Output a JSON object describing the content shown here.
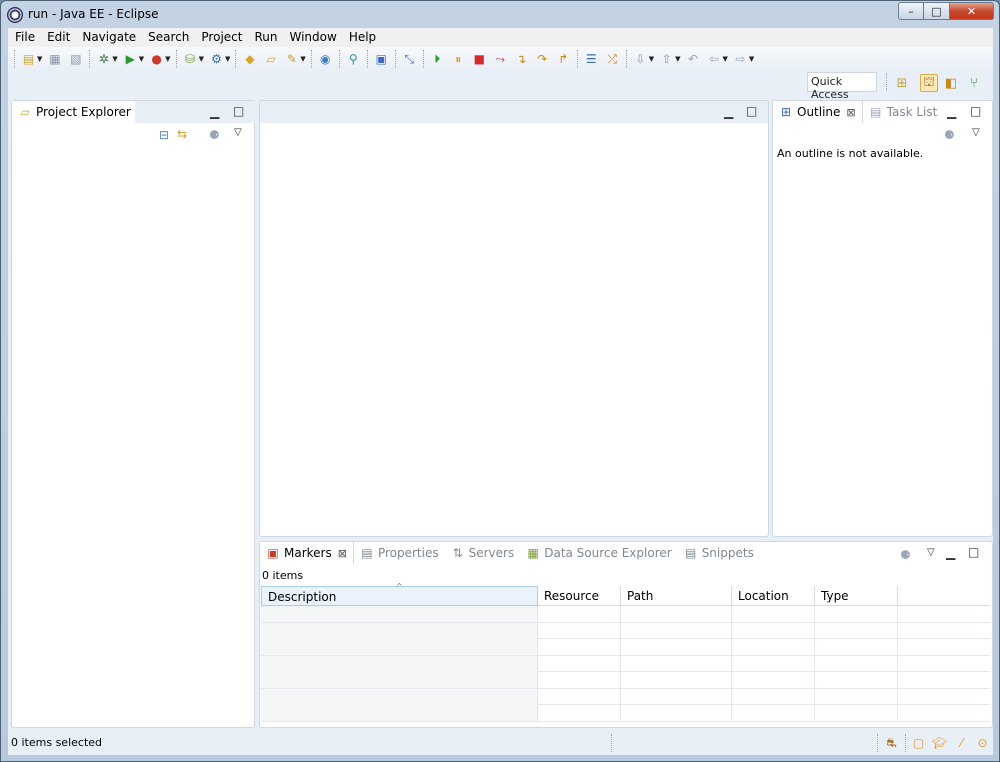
{
  "window": {
    "title": "run - Java EE - Eclipse",
    "min": "–",
    "max": "□",
    "close": "✕"
  },
  "menu": [
    "File",
    "Edit",
    "Navigate",
    "Search",
    "Project",
    "Run",
    "Window",
    "Help"
  ],
  "quick_access": "Quick Access",
  "project_explorer": {
    "title": "Project Explorer",
    "close": "⊠"
  },
  "outline": {
    "title": "Outline",
    "close": "⊠",
    "tab2": "Task List",
    "message": "An outline is not available."
  },
  "bottom": {
    "tabs": [
      "Markers",
      "Properties",
      "Servers",
      "Data Source Explorer",
      "Snippets"
    ],
    "count": "0 items",
    "columns": [
      "Description",
      "Resource",
      "Path",
      "Location",
      "Type"
    ],
    "sort_indicator": "^"
  },
  "status": {
    "selected": "0 items selected"
  },
  "colors": {
    "title_bg": "#c4d3e4",
    "close_btn": "#c6371a",
    "tab_active_bg": "#ffffff"
  },
  "icons": [
    "new-icon",
    "save-icon",
    "debug-icon",
    "run-icon",
    "outline-icon",
    "task-list-icon",
    "markers-icon",
    "perspective-icon",
    "java-ee-perspective-icon"
  ]
}
